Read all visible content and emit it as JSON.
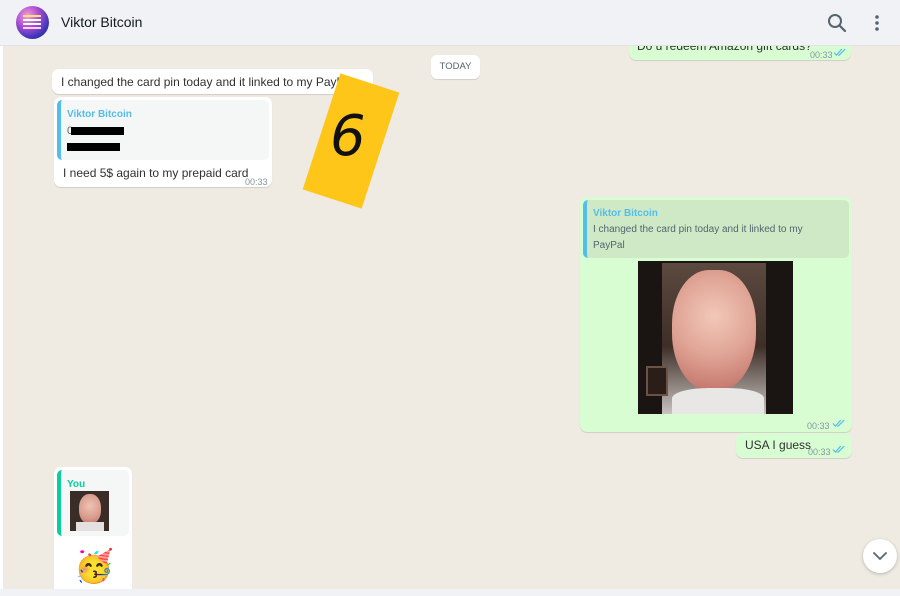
{
  "header": {
    "contact_name": "Viktor Bitcoin"
  },
  "date_chip": "TODAY",
  "messages": {
    "top_partial": {
      "text": "Do u redeem Amazon gift cards?",
      "time": "00:33"
    },
    "incoming_1": {
      "text": "I changed the card pin today and it linked to my PayPal",
      "time": "00:33"
    },
    "incoming_2": {
      "quote_author": "Viktor Bitcoin",
      "quote_line1": "0",
      "text": "I need 5$ again to my prepaid card",
      "time": "00:33"
    },
    "outgoing_photo": {
      "quote_author": "Viktor Bitcoin",
      "quote_text": "I changed the card pin today and it linked to my PayPal",
      "time": "00:33"
    },
    "outgoing_2": {
      "text": "USA I guess",
      "time": "00:33"
    },
    "incoming_3": {
      "quote_author": "You",
      "emoji": "🥳"
    }
  },
  "sticker": {
    "text": "6"
  },
  "colors": {
    "chat_bg": "#efeae2",
    "outgoing_bubble": "#d9fdd3",
    "incoming_bubble": "#ffffff",
    "read_ticks": "#53bdeb",
    "sticker": "#ffc61a"
  },
  "icons": [
    "search-icon",
    "menu-icon",
    "double-check-icon",
    "chevron-down-icon"
  ]
}
